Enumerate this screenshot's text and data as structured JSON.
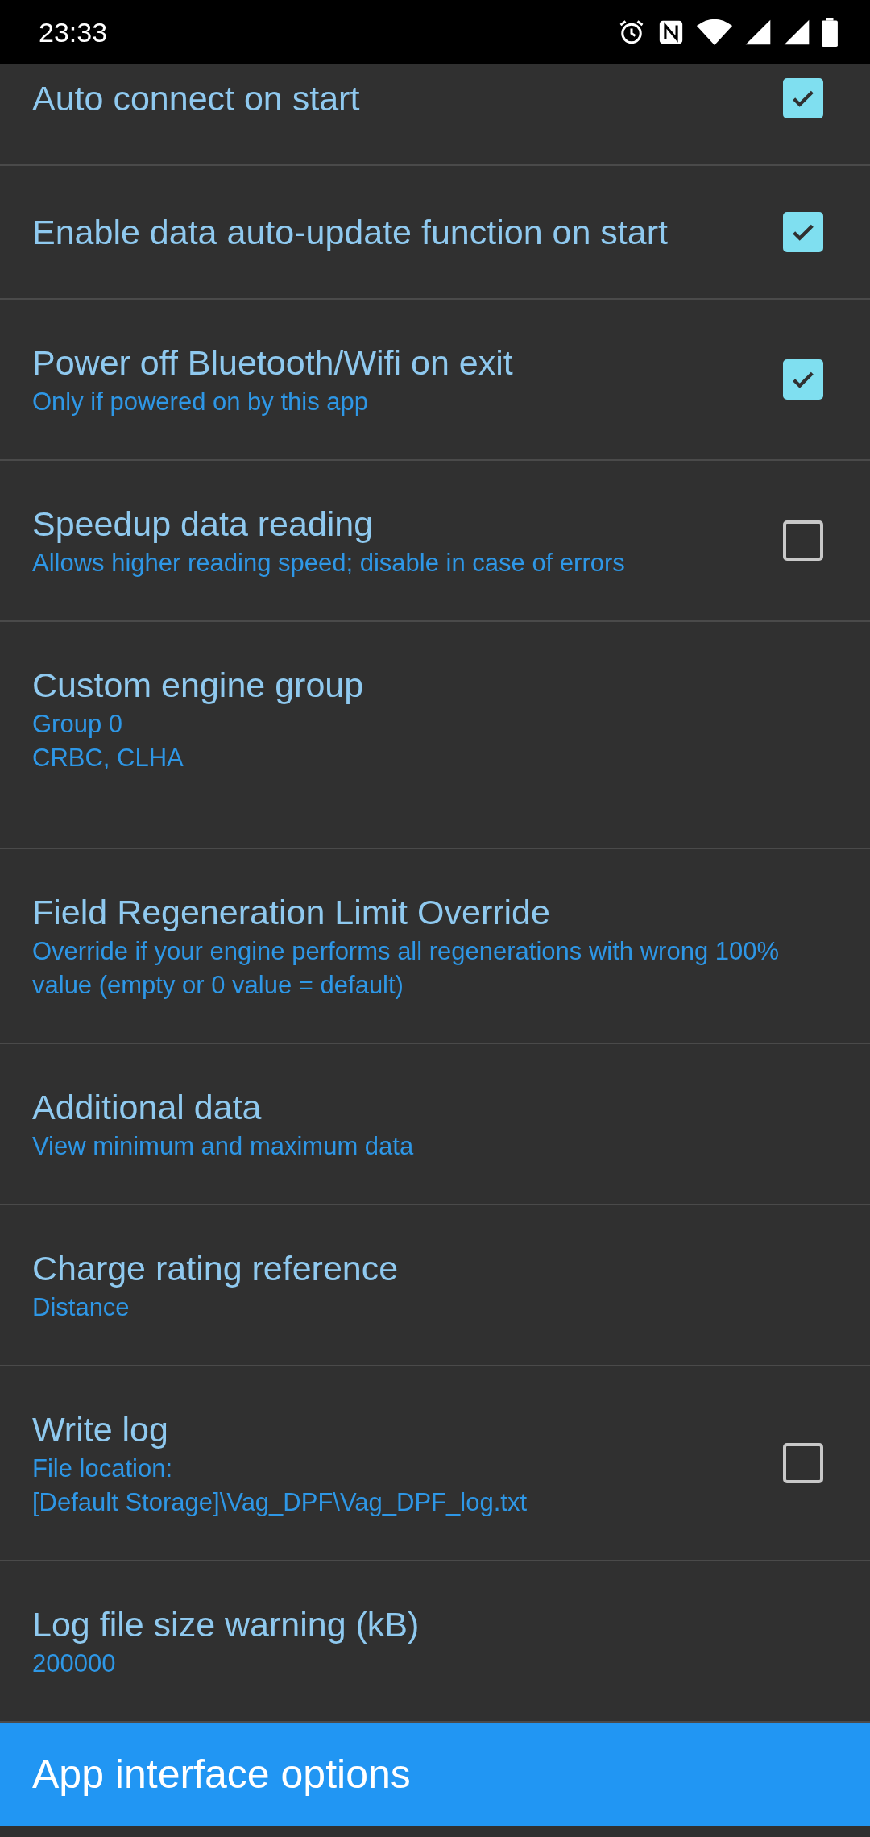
{
  "status_bar": {
    "time": "23:33"
  },
  "preferences": [
    {
      "kind": "checkbox",
      "title": "Auto connect on start",
      "checked": true
    },
    {
      "kind": "checkbox",
      "title": "Enable data auto-update function on start",
      "checked": true
    },
    {
      "kind": "checkbox",
      "title": "Power off Bluetooth/Wifi on exit",
      "summary": [
        "Only if powered on by this app"
      ],
      "checked": true
    },
    {
      "kind": "checkbox",
      "title": "Speedup data reading",
      "summary": [
        "Allows higher reading speed; disable in case of errors"
      ],
      "checked": false
    },
    {
      "kind": "text",
      "title": "Custom engine group",
      "summary": [
        "Group 0",
        "CRBC, CLHA"
      ]
    },
    {
      "kind": "text",
      "title": "Field Regeneration Limit Override",
      "summary": [
        "Override if your engine performs all regenerations with wrong 100% value (empty or 0 value = default)"
      ]
    },
    {
      "kind": "text",
      "title": "Additional data",
      "summary": [
        "View minimum and maximum data"
      ]
    },
    {
      "kind": "text",
      "title": "Charge rating reference",
      "summary": [
        "Distance"
      ]
    },
    {
      "kind": "checkbox",
      "title": "Write log",
      "summary": [
        "File location:",
        "[Default Storage]\\Vag_DPF\\Vag_DPF_log.txt"
      ],
      "checked": false
    },
    {
      "kind": "text",
      "title": "Log file size warning (kB)",
      "summary": [
        "200000"
      ]
    }
  ],
  "section_header": {
    "title": "App interface options"
  }
}
